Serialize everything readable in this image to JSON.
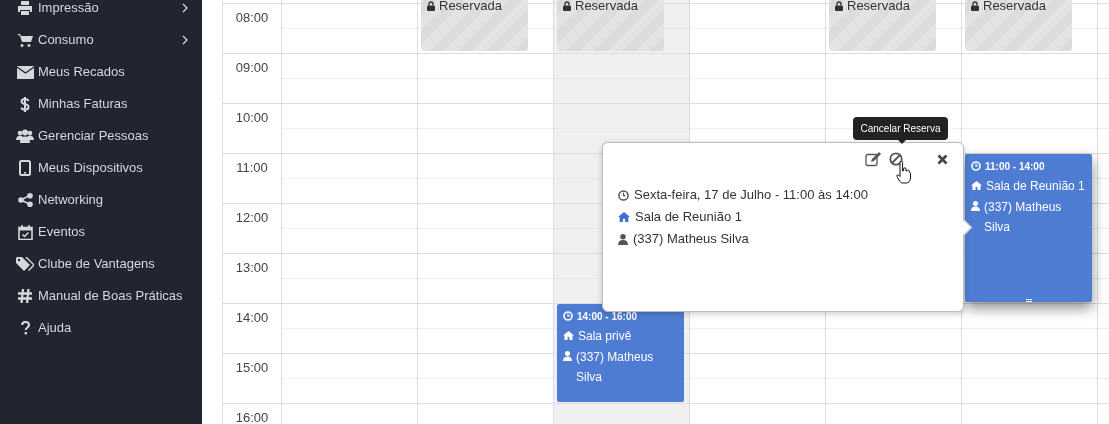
{
  "sidebar": {
    "items": [
      {
        "label": "Impressão",
        "submenu": true
      },
      {
        "label": "Consumo",
        "submenu": true
      },
      {
        "label": "Meus Recados",
        "submenu": false
      },
      {
        "label": "Minhas Faturas",
        "submenu": false
      },
      {
        "label": "Gerenciar Pessoas",
        "submenu": false
      },
      {
        "label": "Meus Dispositivos",
        "submenu": false
      },
      {
        "label": "Networking",
        "submenu": false
      },
      {
        "label": "Eventos",
        "submenu": false
      },
      {
        "label": "Clube de Vantagens",
        "submenu": false
      },
      {
        "label": "Manual de Boas Práticas",
        "submenu": false
      },
      {
        "label": "Ajuda",
        "submenu": false
      }
    ]
  },
  "calendar": {
    "times": [
      "08:00",
      "09:00",
      "10:00",
      "11:00",
      "12:00",
      "13:00",
      "14:00",
      "15:00",
      "16:00"
    ],
    "columns": [
      {
        "today": false
      },
      {
        "today": false,
        "reserved": {
          "label": "Reservada"
        }
      },
      {
        "today": true,
        "reserved": {
          "label": "Reservada"
        },
        "event": {
          "time": "14:00 - 16:00",
          "room": "Sala privê",
          "person": "(337) Matheus Silva",
          "selected": false
        }
      },
      {
        "today": false
      },
      {
        "today": false,
        "reserved": {
          "label": "Reservada"
        }
      },
      {
        "today": false,
        "reserved": {
          "label": "Reservada"
        },
        "event": {
          "time": "11:00 - 14:00",
          "room": "Sala de Reunião 1",
          "person": "(337) Matheus Silva",
          "selected": true
        }
      }
    ]
  },
  "popover": {
    "tooltip": "Cancelar Reserva",
    "date_time": "Sexta-feira, 17 de Julho - 11:00 às 14:00",
    "room": "Sala de Reunião 1",
    "person": "(337) Matheus Silva"
  }
}
